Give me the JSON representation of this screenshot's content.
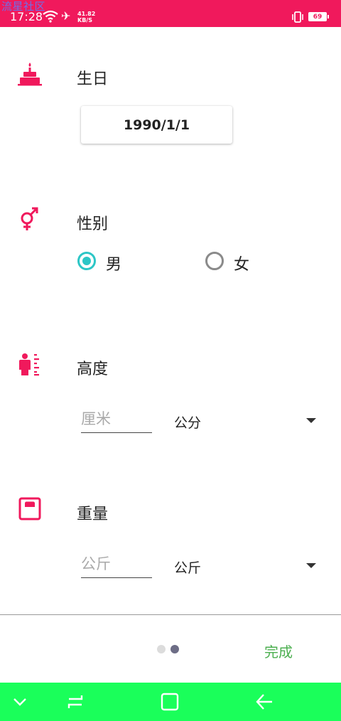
{
  "status_bar": {
    "watermark": "流星社区",
    "time": "17:28",
    "net_speed_value": "41.82",
    "net_speed_unit": "KB/S",
    "battery": "69",
    "icons": [
      "wifi-icon",
      "airplane-icon",
      "vibrate-icon",
      "battery-icon"
    ]
  },
  "birthday": {
    "label": "生日",
    "icon": "cake-icon",
    "value": "1990/1/1"
  },
  "gender": {
    "label": "性别",
    "icon": "gender-icon",
    "options": [
      "男",
      "女"
    ],
    "selected": "男"
  },
  "height": {
    "label": "高度",
    "icon": "height-measure-icon",
    "placeholder": "厘米",
    "unit": "公分"
  },
  "weight": {
    "label": "重量",
    "icon": "scale-icon",
    "placeholder": "公斤",
    "unit": "公斤"
  },
  "footer": {
    "page_count": 2,
    "current_page": 2,
    "done_label": "完成"
  },
  "colors": {
    "accent": "#f0195c",
    "radio": "#2cc6c6",
    "done": "#4caf50",
    "navbar": "#1aff5a"
  },
  "nav_bar": {
    "icons": [
      "collapse-chevron-icon",
      "menu-icon",
      "home-square-icon",
      "back-arrow-icon"
    ]
  }
}
